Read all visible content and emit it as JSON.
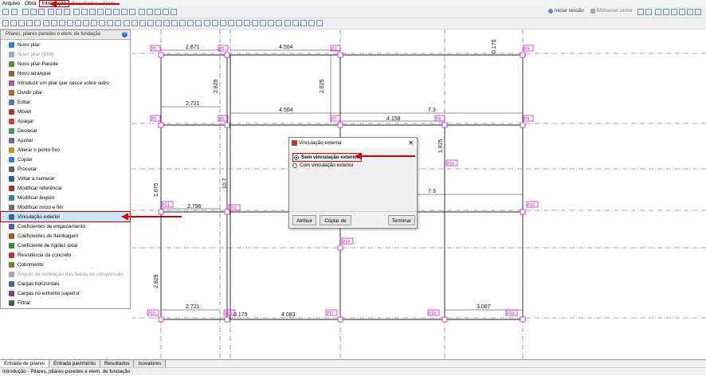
{
  "menu": [
    {
      "label": "Arquivo"
    },
    {
      "label": "Obra"
    },
    {
      "label": "Introdução"
    },
    {
      "label": "Resultados"
    },
    {
      "label": "Ajuda"
    }
  ],
  "toolbar_right": {
    "login": "Iniciar sessão",
    "server": "BIMserver.center"
  },
  "panel": {
    "title": "Pilares, pilares-paredes e elem. de fundação",
    "help": "?",
    "items": [
      {
        "label": "Novo pilar",
        "color": "#3a7bd5"
      },
      {
        "label": "Novo pilar (BIM)",
        "color": "#9ab",
        "disabled": true
      },
      {
        "label": "Novo pilar-Parede",
        "color": "#5a8f3a"
      },
      {
        "label": "Novo arranque",
        "color": "#8a6d2b"
      },
      {
        "label": "Introduzir um pilar que nasce sobre outro",
        "color": "#a05aa0"
      },
      {
        "label": "Dividir pilar",
        "color": "#c06030"
      },
      {
        "label": "Editar",
        "color": "#4a7ab0"
      },
      {
        "label": "Mover",
        "color": "#b03030"
      },
      {
        "label": "Apagar",
        "color": "#d04040"
      },
      {
        "label": "Deslocar",
        "color": "#3a9a6a"
      },
      {
        "label": "Ajustar",
        "color": "#6a6aa0"
      },
      {
        "label": "Alterar o ponto fixo",
        "color": "#c09030"
      },
      {
        "label": "Copiar",
        "color": "#3a7bd5"
      },
      {
        "label": "Procurar",
        "color": "#606060"
      },
      {
        "label": "Voltar a numerar",
        "color": "#306090"
      },
      {
        "label": "Modificar referência",
        "color": "#a03030"
      },
      {
        "label": "Modificar ângulo",
        "color": "#2a8a8a"
      },
      {
        "label": "Modificar início e fim",
        "color": "#707070"
      },
      {
        "label": "Vinculação exterior",
        "color": "#2a6aa0",
        "selected": true
      },
      {
        "label": "Coeficientes de engastamento",
        "color": "#5a5a9a"
      },
      {
        "label": "Coeficientes de flambagem",
        "color": "#9a5a2a"
      },
      {
        "label": "Coeficiente de rigidez axial",
        "color": "#3a8a3a"
      },
      {
        "label": "Resistência do concreto",
        "color": "#c03030"
      },
      {
        "label": "Cobrimento",
        "color": "#6a8a2a"
      },
      {
        "label": "Ângulo de inclinação das bielas de compressão",
        "color": "#aaa",
        "disabled": true
      },
      {
        "label": "Cargas horizontais",
        "color": "#3a6a9a"
      },
      {
        "label": "Cargas no extremo superior",
        "color": "#8a3a8a"
      },
      {
        "label": "Filtrar",
        "color": "#555"
      }
    ]
  },
  "drawing": {
    "dims_top": [
      "2.871",
      "4.504",
      "0.175"
    ],
    "dims_row2": [
      "2.721",
      "4.504",
      "7.3",
      "4.158"
    ],
    "dims_vertical": [
      "2.825",
      "2.825",
      "1.825",
      "1.675",
      "10.7",
      "2.825"
    ],
    "dims_row3": [
      "2.796",
      "7.3"
    ],
    "dims_bottom": [
      "2.721",
      "0.175",
      "4.083",
      "3.067"
    ],
    "column_labels": [
      "P1",
      "P2",
      "P3",
      "P4",
      "P5",
      "P6",
      "P7",
      "P8",
      "P9",
      "P10",
      "P11",
      "P12",
      "P13",
      "P14",
      "P15",
      "P16",
      "P17",
      "P18",
      "P19",
      "P20",
      "P21",
      "P22"
    ]
  },
  "dialog": {
    "title": "Vinculação externa",
    "close": "✕",
    "option_1": "Sem vinculação exterior",
    "option_2": "Com vinculação exterior",
    "btn_assign": "Atribuir",
    "btn_copy": "Copiar de",
    "btn_finish": "Terminar"
  },
  "tabs": [
    {
      "label": "Entrada de pilares",
      "active": true
    },
    {
      "label": "Entrada pavimento"
    },
    {
      "label": "Resultados"
    },
    {
      "label": "Isovalores"
    }
  ],
  "status": "Introdução - Pilares, pilares-paredes e elem. de fundação",
  "colors": {
    "annotation": "#d00000",
    "column_label": "#cc00cc",
    "selection": "#cde4f7"
  }
}
